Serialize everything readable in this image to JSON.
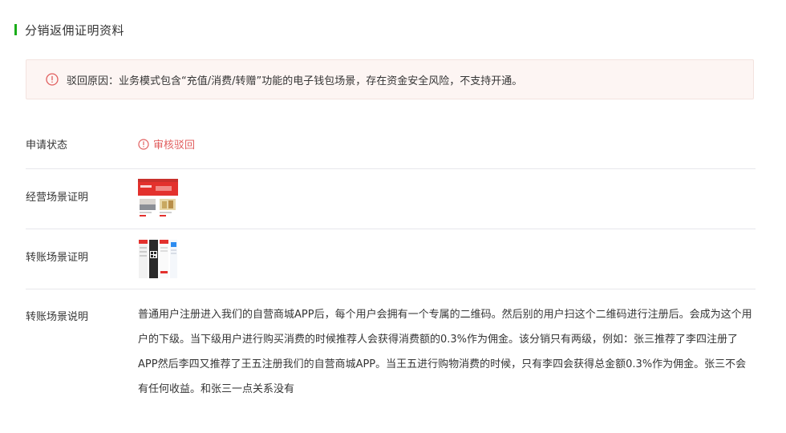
{
  "section": {
    "title": "分销返佣证明资料"
  },
  "alert": {
    "icon": "warning-circle-icon",
    "text": "驳回原因：业务模式包含“充值/消费/转赠”功能的电子钱包场景，存在资金安全风险，不支持开通。",
    "color": "#e15f5f"
  },
  "rows": {
    "status": {
      "label": "申请状态",
      "value": "审核驳回",
      "icon": "warning-circle-icon",
      "color": "#e15f5f"
    },
    "business_scene": {
      "label": "经营场景证明",
      "image": "business-scene-screenshot"
    },
    "transfer_scene": {
      "label": "转账场景证明",
      "image": "transfer-scene-screenshot"
    },
    "transfer_desc": {
      "label": "转账场景说明",
      "text": "普通用户注册进入我们的自营商城APP后，每个用户会拥有一个专属的二维码。然后别的用户扫这个二维码进行注册后。会成为这个用户的下级。当下级用户进行购买消费的时候推荐人会获得消费额的0.3%作为佣金。该分销只有两级，例如：张三推荐了李四注册了APP然后李四又推荐了王五注册我们的自营商城APP。当王五进行购物消费的时候，只有李四会获得总金额0.3%作为佣金。张三不会有任何收益。和张三一点关系没有"
    }
  },
  "colors": {
    "accent": "#1aad19",
    "error": "#e15f5f",
    "alert_bg": "#fdf5f3"
  }
}
